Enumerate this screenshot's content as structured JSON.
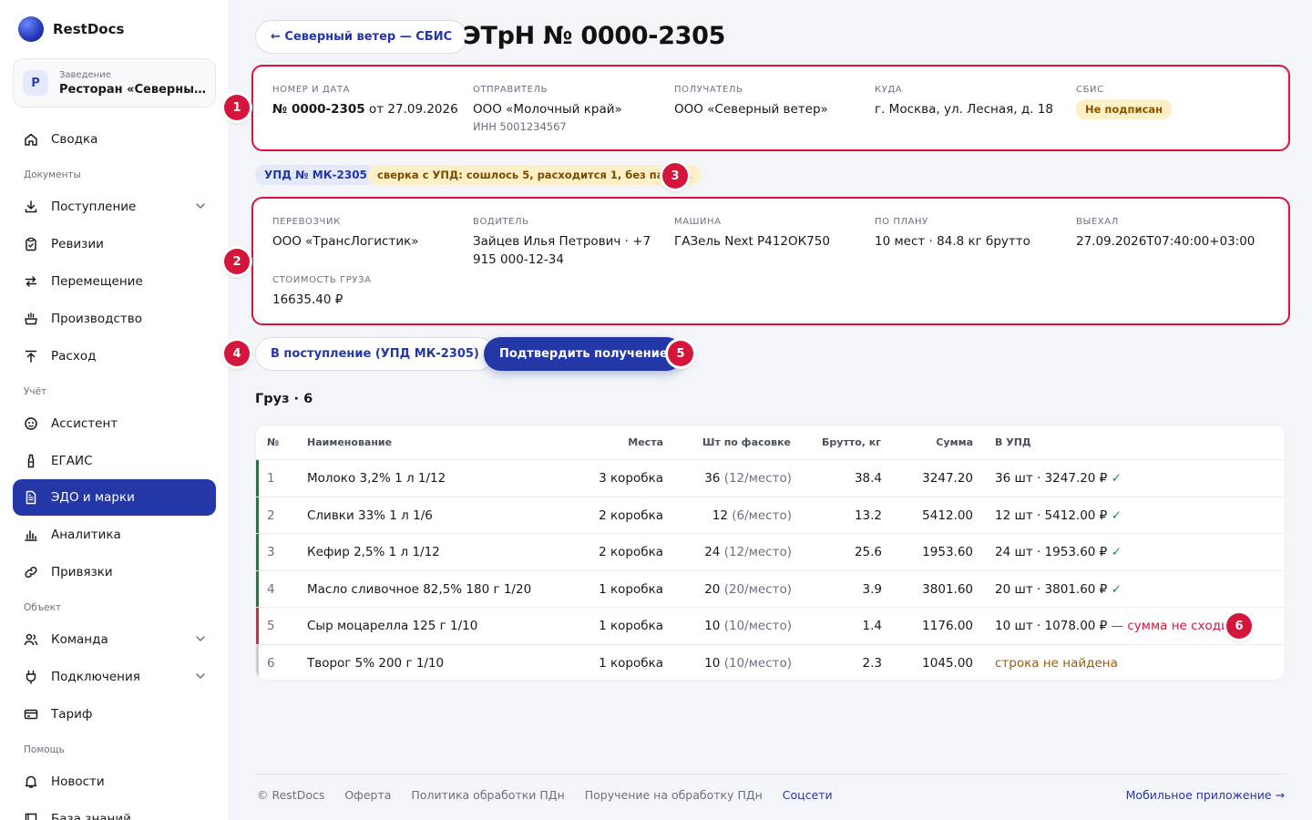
{
  "app": {
    "name": "RestDocs"
  },
  "venue": {
    "avatar": "Р",
    "label": "Заведение",
    "name": "Ресторан «Северный ветер»"
  },
  "sidebar": {
    "items": [
      {
        "label": "Сводка",
        "icon": "home-icon"
      },
      {
        "section": "Документы"
      },
      {
        "label": "Поступление",
        "icon": "download-icon",
        "expandable": true
      },
      {
        "label": "Ревизии",
        "icon": "clipboard-icon"
      },
      {
        "label": "Перемещение",
        "icon": "swap-icon"
      },
      {
        "label": "Производство",
        "icon": "cooking-pot-icon"
      },
      {
        "label": "Расход",
        "icon": "upload-icon"
      },
      {
        "section": "Учёт"
      },
      {
        "label": "Ассистент",
        "icon": "assistant-icon"
      },
      {
        "label": "ЕГАИС",
        "icon": "bottle-icon"
      },
      {
        "label": "ЭДО и марки",
        "icon": "document-icon",
        "active": true
      },
      {
        "label": "Аналитика",
        "icon": "bar-chart-icon"
      },
      {
        "label": "Привязки",
        "icon": "link-icon"
      },
      {
        "section": "Объект"
      },
      {
        "label": "Команда",
        "icon": "users-icon",
        "expandable": true
      },
      {
        "label": "Подключения",
        "icon": "plug-icon",
        "expandable": true
      },
      {
        "label": "Тариф",
        "icon": "card-icon"
      },
      {
        "section": "Помощь"
      },
      {
        "label": "Новости",
        "icon": "bell-icon"
      },
      {
        "label": "База знаний",
        "icon": "book-icon"
      }
    ]
  },
  "header": {
    "back_label": "← Северный ветер — СБИС",
    "title": "ЭТрН № 0000-2305"
  },
  "doc_info": {
    "number_label": "Номер и дата",
    "number_bold": "№ 0000-2305",
    "number_rest": " от 27.09.2026",
    "sender_label": "Отправитель",
    "sender": "ООО «Молочный край»",
    "sender_inn": "ИНН 5001234567",
    "receiver_label": "Получатель",
    "receiver": "ООО «Северный ветер»",
    "dest_label": "Куда",
    "dest": "г. Москва, ул. Лесная, д. 18",
    "sbis_label": "СБИС",
    "sbis_status": "Не подписан"
  },
  "upd": {
    "tag": "УПД № МК-2305",
    "match": "сверка с УПД: сошлось 5, расходится 1, без пары 1"
  },
  "transport": {
    "carrier_label": "Перевозчик",
    "carrier": "ООО «ТрансЛогистик»",
    "driver_label": "Водитель",
    "driver": "Зайцев Илья Петрович · +7 915 000-12-34",
    "vehicle_label": "Машина",
    "vehicle": "ГАЗель Next Р412ОК750",
    "plan_label": "По плану",
    "plan": "10 мест · 84.8 кг брутто",
    "departed_label": "Выехал",
    "departed": "27.09.2026T07:40:00+03:00",
    "cost_label": "Стоимость груза",
    "cost": "16635.40 ₽"
  },
  "actions": {
    "to_receipt": "В поступление (УПД МК-2305)",
    "confirm": "Подтвердить получение"
  },
  "markers": [
    "1",
    "2",
    "3",
    "4",
    "5",
    "6"
  ],
  "cargo": {
    "title": "Груз · 6",
    "columns": [
      "№",
      "Наименование",
      "Места",
      "Шт по фасовке",
      "Брутто, кг",
      "Сумма",
      "В УПД"
    ],
    "rows": [
      {
        "n": "1",
        "name": "Молоко 3,2% 1 л 1/12",
        "places": "3 коробка",
        "qty": "36",
        "per": "(12/место)",
        "gross": "38.4",
        "sum": "3247.20",
        "upd": "36 шт · 3247.20 ₽",
        "upd_note": " ✓",
        "status": "ok"
      },
      {
        "n": "2",
        "name": "Сливки 33% 1 л 1/6",
        "places": "2 коробка",
        "qty": "12",
        "per": "(6/место)",
        "gross": "13.2",
        "sum": "5412.00",
        "upd": "12 шт · 5412.00 ₽",
        "upd_note": " ✓",
        "status": "ok"
      },
      {
        "n": "3",
        "name": "Кефир 2,5% 1 л 1/12",
        "places": "2 коробка",
        "qty": "24",
        "per": "(12/место)",
        "gross": "25.6",
        "sum": "1953.60",
        "upd": "24 шт · 1953.60 ₽",
        "upd_note": " ✓",
        "status": "ok"
      },
      {
        "n": "4",
        "name": "Масло сливочное 82,5% 180 г 1/20",
        "places": "1 коробка",
        "qty": "20",
        "per": "(20/место)",
        "gross": "3.9",
        "sum": "3801.60",
        "upd": "20 шт · 3801.60 ₽",
        "upd_note": " ✓",
        "status": "ok"
      },
      {
        "n": "5",
        "name": "Сыр моцарелла 125 г 1/10",
        "places": "1 коробка",
        "qty": "10",
        "per": "(10/место)",
        "gross": "1.4",
        "sum": "1176.00",
        "upd": "10 шт · 1078.00 ₽",
        "upd_note": " — сумма не сходится",
        "status": "bad"
      },
      {
        "n": "6",
        "name": "Творог 5% 200 г 1/10",
        "places": "1 коробка",
        "qty": "10",
        "per": "(10/место)",
        "gross": "2.3",
        "sum": "1045.00",
        "upd": "",
        "upd_note": "строка не найдена",
        "status": "miss"
      }
    ]
  },
  "footer": {
    "copyright": "© RestDocs",
    "offer": "Оферта",
    "privacy": "Политика обработки ПДн",
    "assignment": "Поручение на обработку ПДн",
    "social": "Соцсети",
    "mobile": "Мобильное приложение →"
  },
  "colors": {
    "accent": "#2437a6",
    "alert": "#d4163c",
    "ok_bar": "#1f7a3a",
    "bad_bar": "#c8323a",
    "miss_bar": "#c9ccd6",
    "warn_bg": "#fdf0c7"
  }
}
